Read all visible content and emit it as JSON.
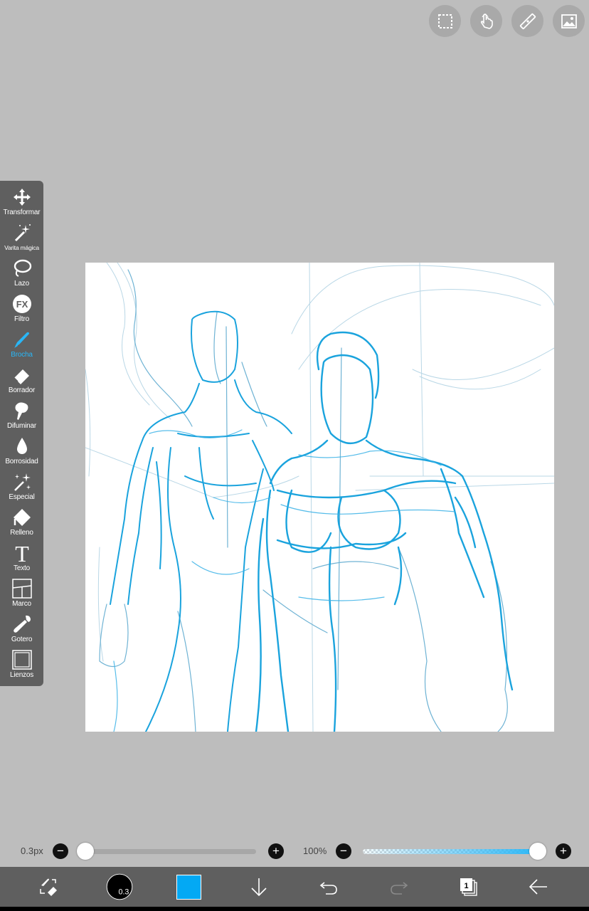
{
  "tools": [
    {
      "label": "Transformar",
      "icon": "move-arrows-icon",
      "active": false
    },
    {
      "label": "Varita mágica",
      "icon": "magic-wand-icon",
      "active": false
    },
    {
      "label": "Lazo",
      "icon": "lasso-icon",
      "active": false
    },
    {
      "label": "Filtro",
      "icon": "fx-filter-icon",
      "active": false
    },
    {
      "label": "Brocha",
      "icon": "brush-icon",
      "active": true
    },
    {
      "label": "Borrador",
      "icon": "eraser-icon",
      "active": false
    },
    {
      "label": "Difuminar",
      "icon": "smudge-icon",
      "active": false
    },
    {
      "label": "Borrosidad",
      "icon": "blur-drop-icon",
      "active": false
    },
    {
      "label": "Especial",
      "icon": "special-sparkle-icon",
      "active": false
    },
    {
      "label": "Relleno",
      "icon": "fill-bucket-icon",
      "active": false
    },
    {
      "label": "Texto",
      "icon": "text-icon",
      "active": false
    },
    {
      "label": "Marco",
      "icon": "frame-icon",
      "active": false
    },
    {
      "label": "Gotero",
      "icon": "eyedropper-icon",
      "active": false
    },
    {
      "label": "Lienzos",
      "icon": "canvas-icon",
      "active": false
    }
  ],
  "top_buttons": [
    "selection-icon",
    "hand-touch-icon",
    "ruler-icon",
    "image-icon"
  ],
  "brush": {
    "size_label": "0.3px",
    "size_fraction": 0.0,
    "badge": "0.3"
  },
  "opacity": {
    "label": "100%",
    "fraction": 1.0
  },
  "fx_text": "FX",
  "text_glyph": "T",
  "layers_badge": "1",
  "colors": {
    "background": "#bdbdbd",
    "toolbar": "#5f5f5f",
    "accent": "#29b6f6",
    "current_color": "#03a9f4",
    "sketch": "#1aa3dd"
  }
}
